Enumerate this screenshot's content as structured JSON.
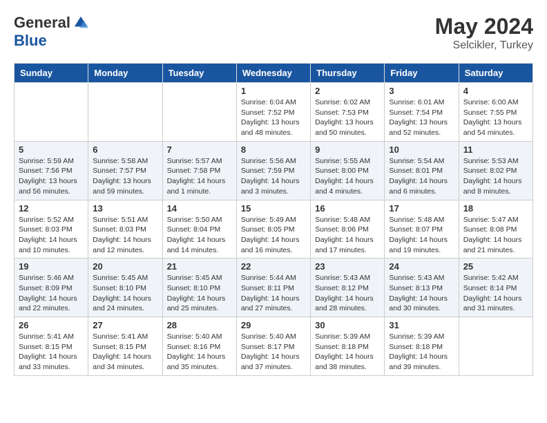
{
  "header": {
    "logo_general": "General",
    "logo_blue": "Blue",
    "month_year": "May 2024",
    "location": "Selcikler, Turkey"
  },
  "days_of_week": [
    "Sunday",
    "Monday",
    "Tuesday",
    "Wednesday",
    "Thursday",
    "Friday",
    "Saturday"
  ],
  "weeks": [
    [
      {
        "day": "",
        "info": ""
      },
      {
        "day": "",
        "info": ""
      },
      {
        "day": "",
        "info": ""
      },
      {
        "day": "1",
        "info": "Sunrise: 6:04 AM\nSunset: 7:52 PM\nDaylight: 13 hours\nand 48 minutes."
      },
      {
        "day": "2",
        "info": "Sunrise: 6:02 AM\nSunset: 7:53 PM\nDaylight: 13 hours\nand 50 minutes."
      },
      {
        "day": "3",
        "info": "Sunrise: 6:01 AM\nSunset: 7:54 PM\nDaylight: 13 hours\nand 52 minutes."
      },
      {
        "day": "4",
        "info": "Sunrise: 6:00 AM\nSunset: 7:55 PM\nDaylight: 13 hours\nand 54 minutes."
      }
    ],
    [
      {
        "day": "5",
        "info": "Sunrise: 5:59 AM\nSunset: 7:56 PM\nDaylight: 13 hours\nand 56 minutes."
      },
      {
        "day": "6",
        "info": "Sunrise: 5:58 AM\nSunset: 7:57 PM\nDaylight: 13 hours\nand 59 minutes."
      },
      {
        "day": "7",
        "info": "Sunrise: 5:57 AM\nSunset: 7:58 PM\nDaylight: 14 hours\nand 1 minute."
      },
      {
        "day": "8",
        "info": "Sunrise: 5:56 AM\nSunset: 7:59 PM\nDaylight: 14 hours\nand 3 minutes."
      },
      {
        "day": "9",
        "info": "Sunrise: 5:55 AM\nSunset: 8:00 PM\nDaylight: 14 hours\nand 4 minutes."
      },
      {
        "day": "10",
        "info": "Sunrise: 5:54 AM\nSunset: 8:01 PM\nDaylight: 14 hours\nand 6 minutes."
      },
      {
        "day": "11",
        "info": "Sunrise: 5:53 AM\nSunset: 8:02 PM\nDaylight: 14 hours\nand 8 minutes."
      }
    ],
    [
      {
        "day": "12",
        "info": "Sunrise: 5:52 AM\nSunset: 8:03 PM\nDaylight: 14 hours\nand 10 minutes."
      },
      {
        "day": "13",
        "info": "Sunrise: 5:51 AM\nSunset: 8:03 PM\nDaylight: 14 hours\nand 12 minutes."
      },
      {
        "day": "14",
        "info": "Sunrise: 5:50 AM\nSunset: 8:04 PM\nDaylight: 14 hours\nand 14 minutes."
      },
      {
        "day": "15",
        "info": "Sunrise: 5:49 AM\nSunset: 8:05 PM\nDaylight: 14 hours\nand 16 minutes."
      },
      {
        "day": "16",
        "info": "Sunrise: 5:48 AM\nSunset: 8:06 PM\nDaylight: 14 hours\nand 17 minutes."
      },
      {
        "day": "17",
        "info": "Sunrise: 5:48 AM\nSunset: 8:07 PM\nDaylight: 14 hours\nand 19 minutes."
      },
      {
        "day": "18",
        "info": "Sunrise: 5:47 AM\nSunset: 8:08 PM\nDaylight: 14 hours\nand 21 minutes."
      }
    ],
    [
      {
        "day": "19",
        "info": "Sunrise: 5:46 AM\nSunset: 8:09 PM\nDaylight: 14 hours\nand 22 minutes."
      },
      {
        "day": "20",
        "info": "Sunrise: 5:45 AM\nSunset: 8:10 PM\nDaylight: 14 hours\nand 24 minutes."
      },
      {
        "day": "21",
        "info": "Sunrise: 5:45 AM\nSunset: 8:10 PM\nDaylight: 14 hours\nand 25 minutes."
      },
      {
        "day": "22",
        "info": "Sunrise: 5:44 AM\nSunset: 8:11 PM\nDaylight: 14 hours\nand 27 minutes."
      },
      {
        "day": "23",
        "info": "Sunrise: 5:43 AM\nSunset: 8:12 PM\nDaylight: 14 hours\nand 28 minutes."
      },
      {
        "day": "24",
        "info": "Sunrise: 5:43 AM\nSunset: 8:13 PM\nDaylight: 14 hours\nand 30 minutes."
      },
      {
        "day": "25",
        "info": "Sunrise: 5:42 AM\nSunset: 8:14 PM\nDaylight: 14 hours\nand 31 minutes."
      }
    ],
    [
      {
        "day": "26",
        "info": "Sunrise: 5:41 AM\nSunset: 8:15 PM\nDaylight: 14 hours\nand 33 minutes."
      },
      {
        "day": "27",
        "info": "Sunrise: 5:41 AM\nSunset: 8:15 PM\nDaylight: 14 hours\nand 34 minutes."
      },
      {
        "day": "28",
        "info": "Sunrise: 5:40 AM\nSunset: 8:16 PM\nDaylight: 14 hours\nand 35 minutes."
      },
      {
        "day": "29",
        "info": "Sunrise: 5:40 AM\nSunset: 8:17 PM\nDaylight: 14 hours\nand 37 minutes."
      },
      {
        "day": "30",
        "info": "Sunrise: 5:39 AM\nSunset: 8:18 PM\nDaylight: 14 hours\nand 38 minutes."
      },
      {
        "day": "31",
        "info": "Sunrise: 5:39 AM\nSunset: 8:18 PM\nDaylight: 14 hours\nand 39 minutes."
      },
      {
        "day": "",
        "info": ""
      }
    ]
  ]
}
